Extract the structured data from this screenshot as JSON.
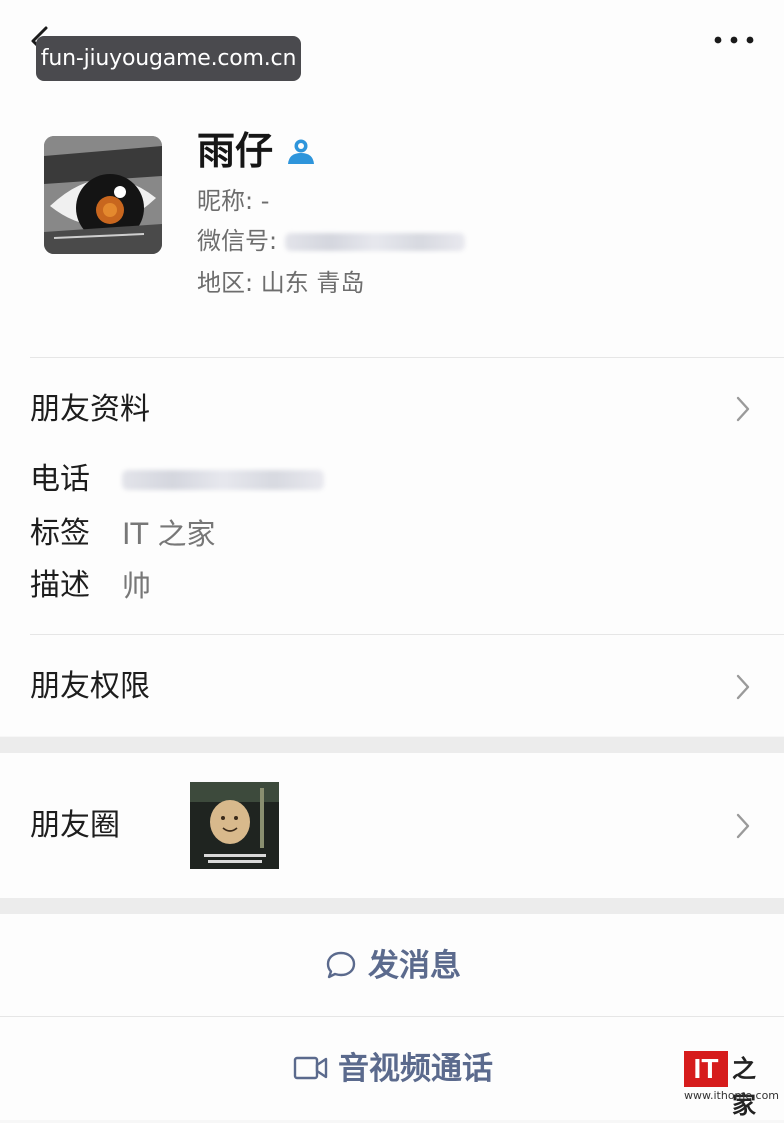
{
  "topbar": {
    "url_badge": "fun-jiuyougame.com.cn"
  },
  "profile": {
    "name": "雨仔",
    "nickname": "昵称: -",
    "wechat_id_label": "微信号:",
    "region": "地区: 山东 青岛"
  },
  "friend_info": {
    "title": "朋友资料",
    "phone_label": "电话",
    "tags_label": "标签",
    "tags_value": "IT 之家",
    "desc_label": "描述",
    "desc_value": "帅"
  },
  "permissions": {
    "title": "朋友权限"
  },
  "moments": {
    "title": "朋友圈"
  },
  "actions": {
    "message": "发消息",
    "call": "音视频通话"
  },
  "watermark": {
    "logo": "IT",
    "logo_text": "之家",
    "url": "www.ithome.com"
  },
  "colors": {
    "accent_link": "#5b6a8d",
    "contact_icon": "#2e95db",
    "url_badge_bg": "#4a4a4e",
    "brand_red": "#d61c1c"
  }
}
